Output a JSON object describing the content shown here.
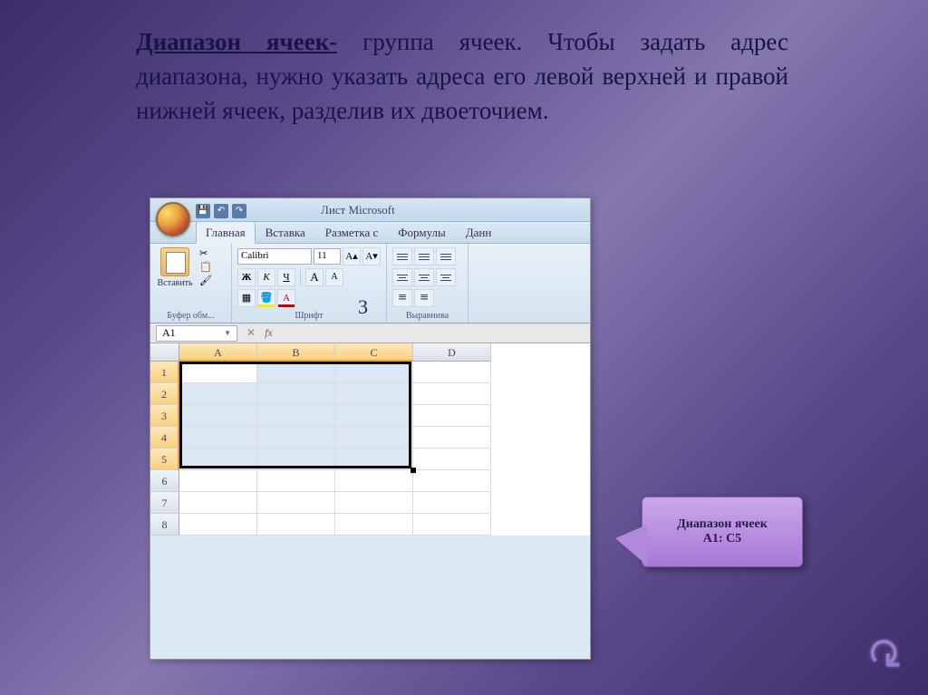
{
  "definition": {
    "term": "Диапазон ячеек-",
    "body": " группа ячеек. Чтобы задать адрес диапазона, нужно указать адреса его левой верхней и правой нижней ячеек, разделив их двоеточием."
  },
  "overlay_number": "3",
  "excel": {
    "title": "Лист Microsoft",
    "tabs": {
      "home": "Главная",
      "insert": "Вставка",
      "layout": "Разметка с",
      "formulas": "Формулы",
      "data": "Данн"
    },
    "ribbon": {
      "paste_label": "Вставить",
      "clipboard_group": "Буфер обм...",
      "font_name": "Calibri",
      "font_size": "11",
      "bold": "Ж",
      "italic": "К",
      "underline": "Ч",
      "grow": "А",
      "shrink": "А",
      "font_group": "Шрифт",
      "align_group": "Выравнива"
    },
    "name_box": "A1",
    "fx": "fx",
    "columns": [
      "A",
      "B",
      "C",
      "D"
    ],
    "rows": [
      "1",
      "2",
      "3",
      "4",
      "5",
      "6",
      "7",
      "8"
    ],
    "selected_cols": 3,
    "selected_rows": 5
  },
  "callout": {
    "line1": "Диапазон ячеек",
    "line2": "А1: С5"
  },
  "back_arrow": "↻"
}
